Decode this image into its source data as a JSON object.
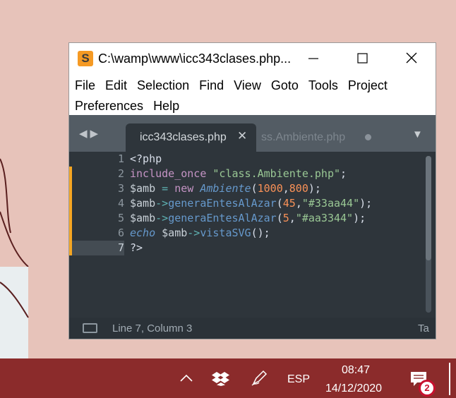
{
  "window": {
    "title": "C:\\wamp\\www\\icc343clases.php...",
    "controls": [
      "minimize-icon",
      "maximize-icon",
      "close-icon"
    ]
  },
  "menu": {
    "items": [
      "File",
      "Edit",
      "Selection",
      "Find",
      "View",
      "Goto",
      "Tools",
      "Project",
      "Preferences",
      "Help"
    ]
  },
  "tabs": [
    {
      "label": "icc343clases.php",
      "active": true
    },
    {
      "label": "class.Ambiente.php",
      "visible_label": "ss.Ambiente.php",
      "active": false
    }
  ],
  "code": {
    "line_numbers": [
      "1",
      "2",
      "3",
      "4",
      "5",
      "6",
      "7"
    ],
    "lines": [
      "<?php",
      "include_once \"class.Ambiente.php\";",
      "$amb = new Ambiente(1000,800);",
      "$amb->generaEntesAlAzar(45,\"#33aa44\");",
      "$amb->generaEntesAlAzar(5,\"#aa3344\");",
      "echo $amb->vistaSVG();",
      "?>"
    ],
    "modified_lines": [
      2,
      3,
      4,
      5,
      6,
      7
    ],
    "current_line": 7
  },
  "status": {
    "position": "Line 7, Column 3",
    "right": "Ta"
  },
  "taskbar": {
    "language": "ESP",
    "time": "08:47",
    "date": "14/12/2020",
    "notification_count": "2",
    "icons": [
      "chevron-up-icon",
      "dropbox-icon",
      "pen-icon",
      "notification-icon"
    ]
  },
  "colors": {
    "accent": "#f5a623",
    "editor_bg": "#2e353b",
    "taskbar_bg": "#8b2b2b",
    "desktop_bg": "#e7c3ba"
  }
}
